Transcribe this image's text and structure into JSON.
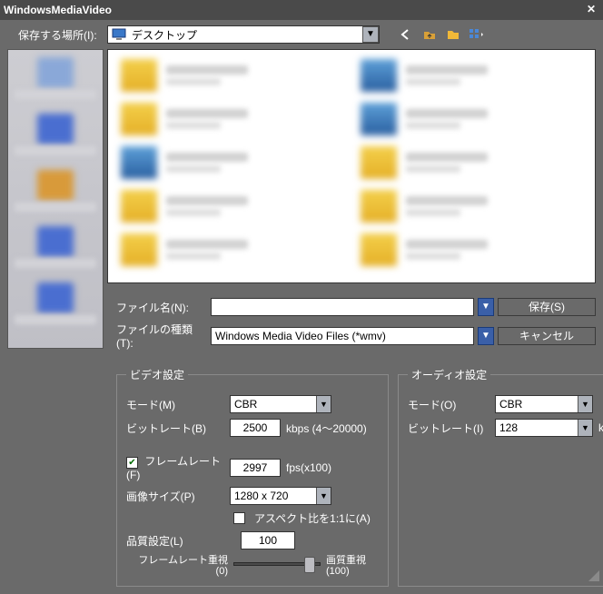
{
  "window": {
    "title": "WindowsMediaVideo"
  },
  "toprow": {
    "location_label": "保存する場所(I):",
    "location_value": "デスクトップ"
  },
  "filefields": {
    "filename_label": "ファイル名(N):",
    "filename_value": "",
    "filetype_label": "ファイルの種類(T):",
    "filetype_value": "Windows Media Video Files (*wmv)",
    "save_button": "保存(S)",
    "cancel_button": "キャンセル"
  },
  "video": {
    "legend": "ビデオ設定",
    "mode_label": "モード(M)",
    "mode_value": "CBR",
    "bitrate_label": "ビットレート(B)",
    "bitrate_value": "2500",
    "bitrate_unit": "kbps (4～20000)",
    "framerate_checked": true,
    "framerate_label": "フレームレート(F)",
    "framerate_value": "2997",
    "framerate_unit": "fps(x100)",
    "imagesize_label": "画像サイズ(P)",
    "imagesize_value": "1280 x 720",
    "aspect_lock_label": "アスペクト比を1:1に(A)",
    "aspect_lock_checked": false,
    "quality_label": "品質設定(L)",
    "quality_value": "100",
    "slider_left_label": "フレームレート重視",
    "slider_left_sub": "(0)",
    "slider_right_label": "画質重視",
    "slider_right_sub": "(100)"
  },
  "audio": {
    "legend": "オーディオ設定",
    "mode_label": "モード(O)",
    "mode_value": "CBR",
    "bitrate_label": "ビットレート(I)",
    "bitrate_value": "128",
    "bitrate_unit": "kbps"
  }
}
